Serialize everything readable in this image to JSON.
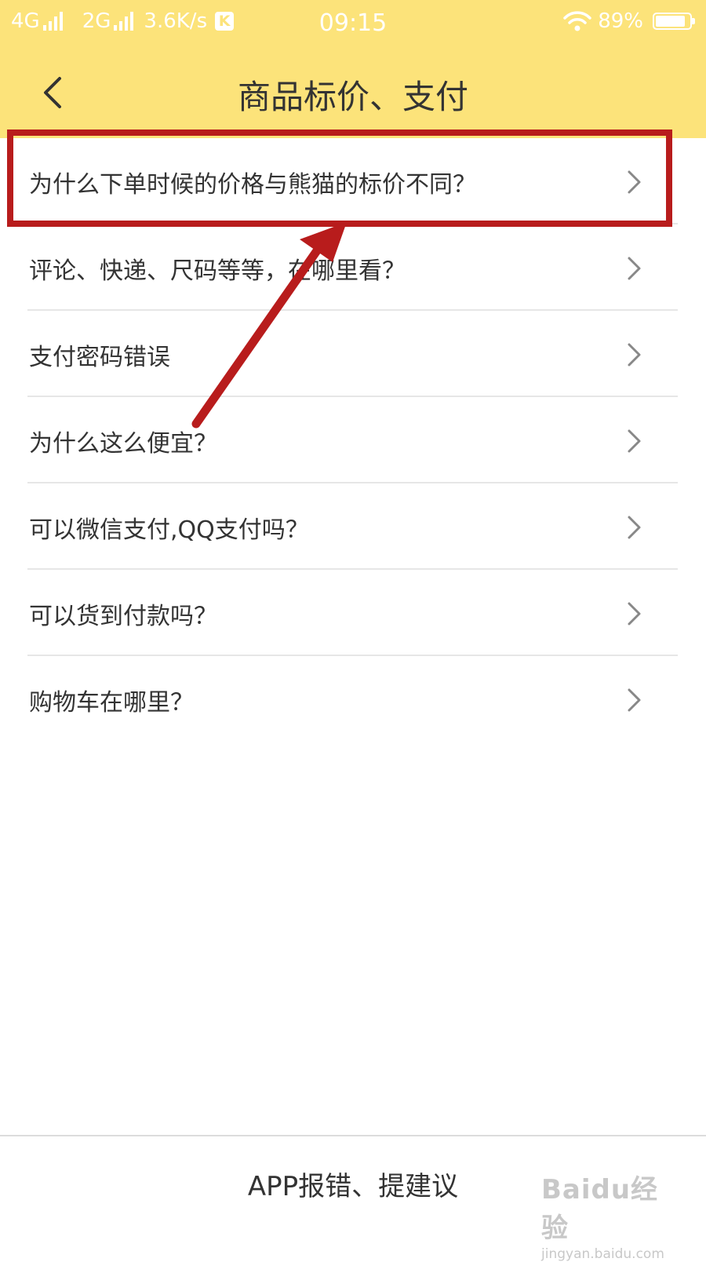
{
  "status_bar": {
    "network_1": "4G",
    "network_2": "2G",
    "speed": "3.6K/s",
    "app_badge": "K",
    "time": "09:15",
    "battery_level": "89%",
    "battery_fraction": 0.89
  },
  "header": {
    "title": "商品标价、支付",
    "back_icon": "chevron-left-icon"
  },
  "faq": {
    "items": [
      {
        "label": "为什么下单时候的价格与熊猫的标价不同？"
      },
      {
        "label": "评论、快递、尺码等等，在哪里看？"
      },
      {
        "label": "支付密码错误"
      },
      {
        "label": "为什么这么便宜？"
      },
      {
        "label": "可以微信支付,QQ支付吗？"
      },
      {
        "label": "可以货到付款吗？"
      },
      {
        "label": "购物车在哪里？"
      }
    ],
    "chevron_icon": "chevron-right-icon"
  },
  "footer": {
    "feedback_label": "APP报错、提建议"
  },
  "watermark": {
    "main": "Baidu经验",
    "sub": "jingyan.baidu.com"
  },
  "colors": {
    "header_bg": "#fce37a",
    "annotation": "#b81c1c",
    "text": "#333333",
    "divider": "#e6e6e6"
  }
}
